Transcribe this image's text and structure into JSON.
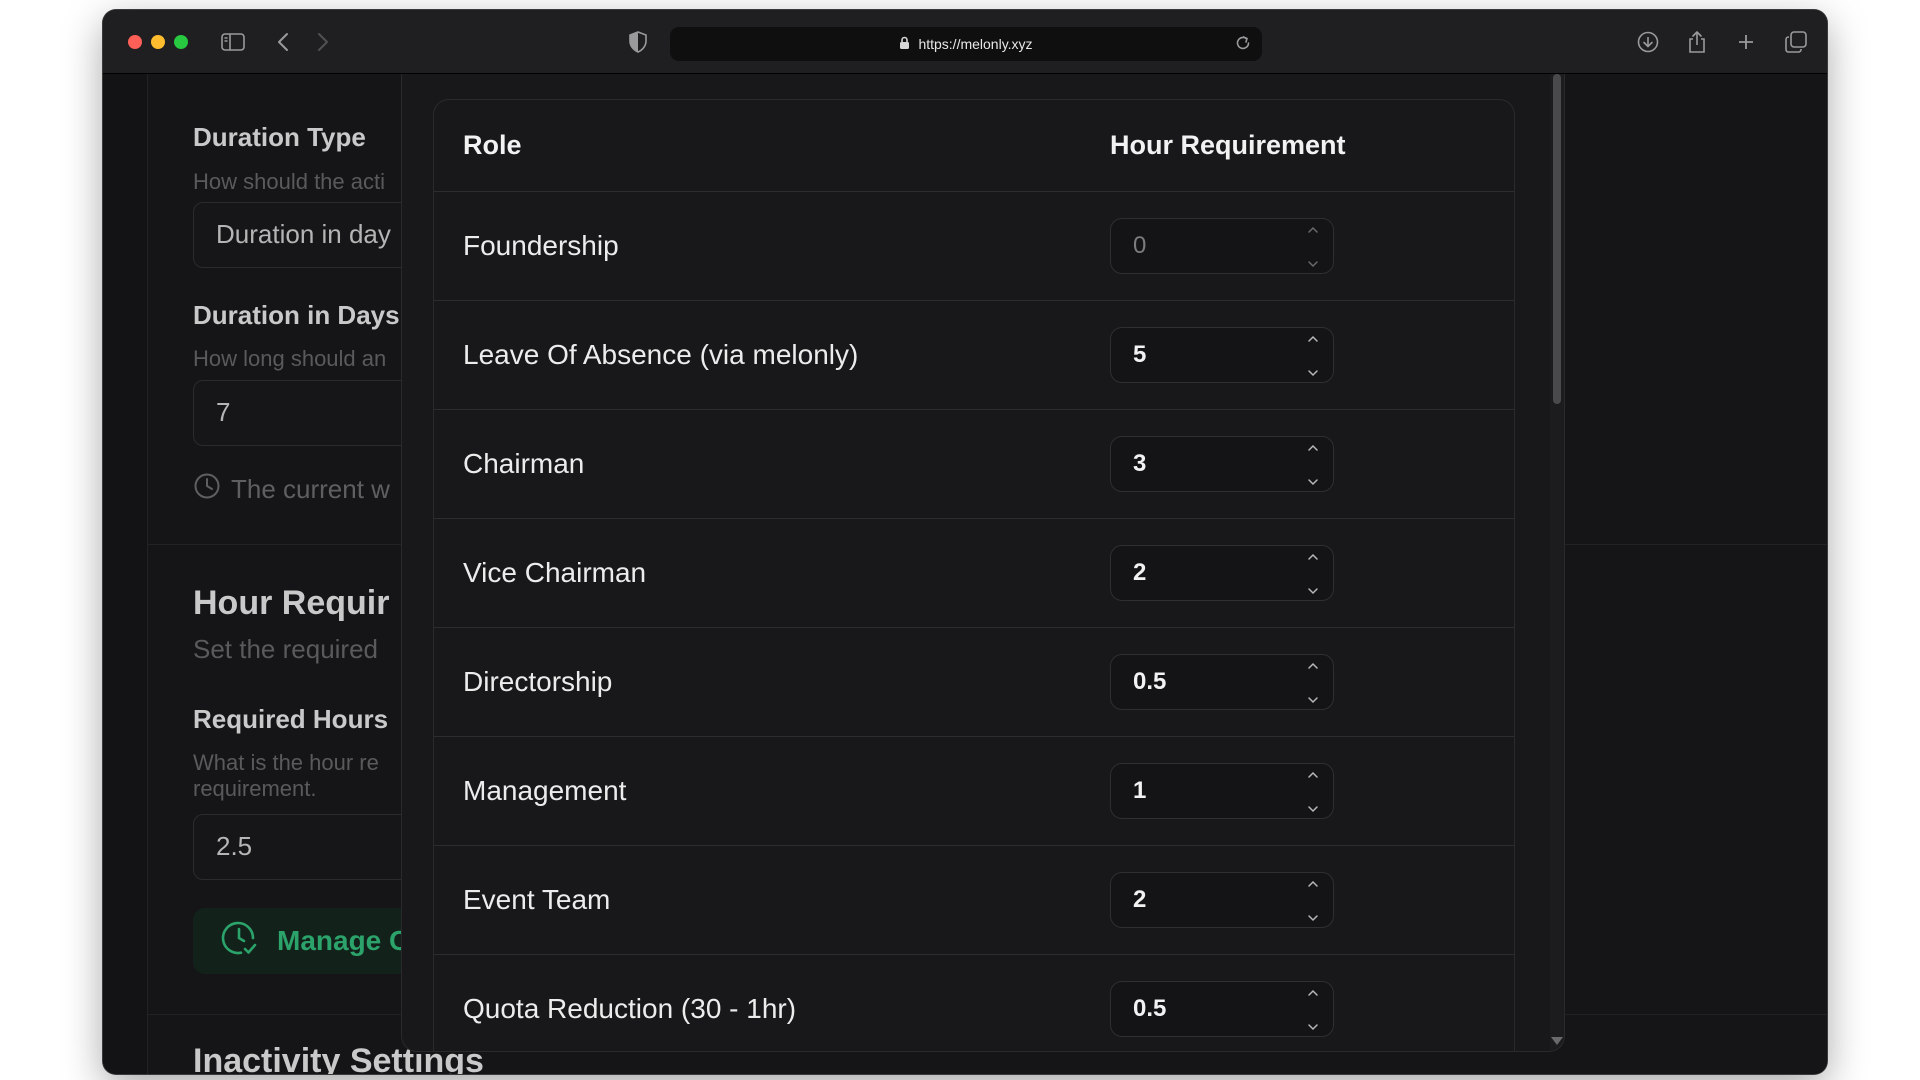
{
  "browser": {
    "url": "https://melonly.xyz"
  },
  "background": {
    "duration_type_label": "Duration Type",
    "duration_type_help": "How should the acti",
    "duration_type_value": "Duration in day",
    "duration_days_label": "Duration in Days",
    "duration_days_help": "How long should an",
    "duration_days_value": "7",
    "current_notice": "The current w",
    "hour_req_heading": "Hour Requir",
    "hour_req_help": "Set the required",
    "required_hours_label": "Required Hours",
    "required_hours_help_1": "What is the hour re",
    "required_hours_help_2": "requirement.",
    "required_hours_value": "2.5",
    "manage_button": "Manage C",
    "inactivity_heading": "Inactivity Settings"
  },
  "modal": {
    "table": {
      "col_role": "Role",
      "col_hours": "Hour Requirement",
      "rows": [
        {
          "role": "Foundership",
          "hours": "0"
        },
        {
          "role": "Leave Of Absence (via melonly)",
          "hours": "5"
        },
        {
          "role": "Chairman",
          "hours": "3"
        },
        {
          "role": "Vice Chairman",
          "hours": "2"
        },
        {
          "role": "Directorship",
          "hours": "0.5"
        },
        {
          "role": "Management",
          "hours": "1"
        },
        {
          "role": "Event Team",
          "hours": "2"
        },
        {
          "role": "Quota Reduction (30 - 1hr)",
          "hours": "0.5"
        }
      ]
    }
  },
  "colors": {
    "accent_green": "#2ba36a",
    "traffic_red": "#fe5f57",
    "traffic_yellow": "#febc2e",
    "traffic_green": "#28c840"
  }
}
